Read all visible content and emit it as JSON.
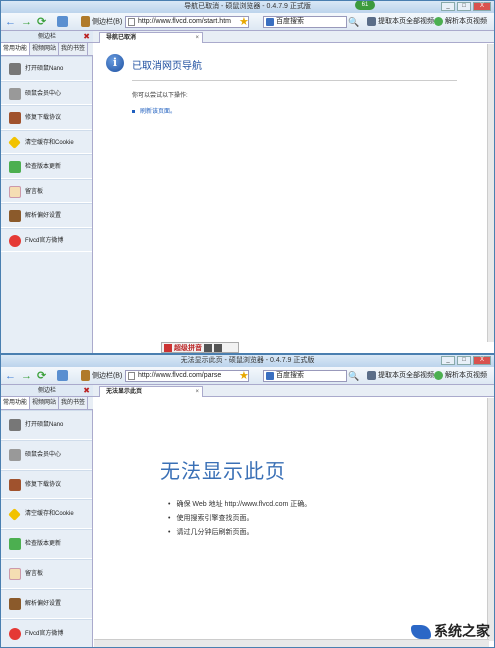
{
  "window1": {
    "title": "导航已取消 - 硕鼠浏览器 - 0.4.7.9 正式版",
    "badge": "61",
    "controls": [
      "_",
      "□",
      "X"
    ],
    "toolbar": {
      "sidebar_label": "侧边栏(B)",
      "address": "http://www.flvcd.com/start.htm",
      "search_placeholder": "百度搜索",
      "extract_label": "提取本页全部视频",
      "parse_label": "解析本页视频"
    },
    "sidebar": {
      "header": "侧边栏",
      "close": "✖",
      "tabs": [
        "常用功能",
        "视频网站",
        "我的书签"
      ],
      "items": [
        {
          "label": "打开硕鼠Nano",
          "icon": "nano-icon"
        },
        {
          "label": "硕鼠会员中心",
          "icon": "member-icon"
        },
        {
          "label": "修复下载协议",
          "icon": "repair-icon"
        },
        {
          "label": "清空缓存和Cookie",
          "icon": "warning-icon"
        },
        {
          "label": "检查版本更新",
          "icon": "puzzle-icon"
        },
        {
          "label": "留言板",
          "icon": "note-icon"
        },
        {
          "label": "解析偏好设置",
          "icon": "settings-icon"
        },
        {
          "label": "Flvcd官方微博",
          "icon": "weibo-icon"
        }
      ]
    },
    "tab": {
      "label": "导航已取消",
      "close": "×"
    },
    "page": {
      "heading": "已取消网页导航",
      "hint": "你可以尝试以下操作:",
      "action": "刷新该页面。"
    },
    "ime_bar": "超级拼音"
  },
  "window2": {
    "title": "无法显示此页 - 硕鼠浏览器 - 0.4.7.9 正式版",
    "toolbar": {
      "sidebar_label": "侧边栏(B)",
      "address": "http://www.flvcd.com/parse",
      "search_placeholder": "百度搜索",
      "extract_label": "提取本页全部视频",
      "parse_label": "解析本页视频"
    },
    "sidebar": {
      "header": "侧边栏",
      "close": "✖",
      "tabs": [
        "常用功能",
        "视频网站",
        "我的书签"
      ],
      "items": [
        {
          "label": "打开硕鼠Nano"
        },
        {
          "label": "硕鼠会员中心"
        },
        {
          "label": "修复下载协议"
        },
        {
          "label": "清空缓存和Cookie"
        },
        {
          "label": "检查版本更新"
        },
        {
          "label": "留言板"
        },
        {
          "label": "解析偏好设置"
        },
        {
          "label": "Flvcd官方微博"
        }
      ]
    },
    "tab": {
      "label": "无法显示此页",
      "close": "×"
    },
    "page": {
      "heading": "无法显示此页",
      "bullets": [
        "确保 Web 地址 http://www.flvcd.com 正确。",
        "使用搜索引擎查找页面。",
        "请过几分钟后刷新页面。"
      ]
    },
    "watermark": "系统之家"
  }
}
